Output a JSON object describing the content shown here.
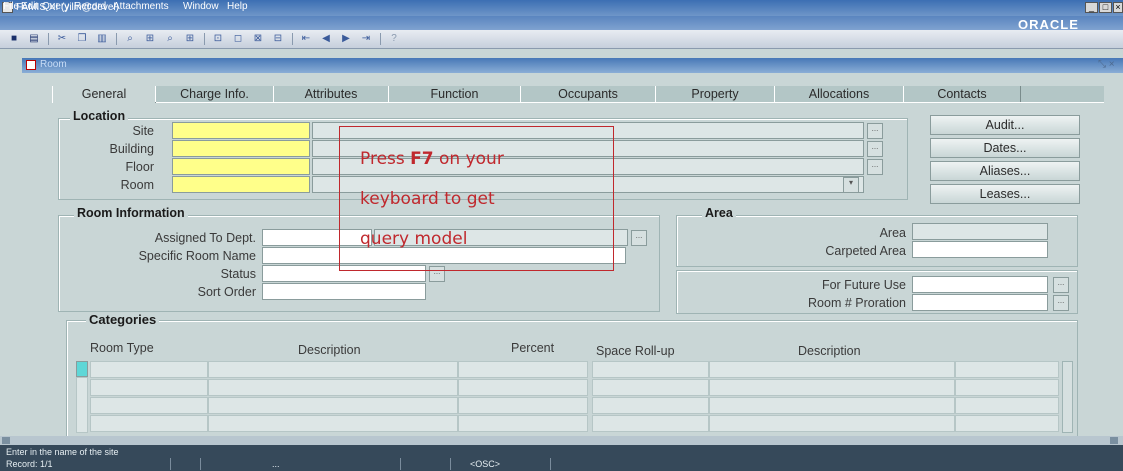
{
  "window": {
    "title": "FAMIS XI (yilin@devel)",
    "brand": "ORACLE"
  },
  "menu": [
    "File",
    "Edit",
    "Query",
    "Record",
    "Attachments",
    "Window",
    "Help"
  ],
  "form": {
    "title": "Room"
  },
  "tabs": [
    "General",
    "Charge Info.",
    "Attributes",
    "Function",
    "Occupants",
    "Property",
    "Allocations",
    "Contacts"
  ],
  "location": {
    "title": "Location",
    "labels": [
      "Site",
      "Building",
      "Floor",
      "Room"
    ]
  },
  "buttons": [
    "Audit...",
    "Dates...",
    "Aliases...",
    "Leases..."
  ],
  "room_info": {
    "title": "Room Information",
    "labels": [
      "Assigned To Dept.",
      "Specific Room Name",
      "Status",
      "Sort Order"
    ]
  },
  "area": {
    "title": "Area",
    "labels": [
      "Area",
      "Carpeted Area",
      "For Future Use",
      "Room # Proration"
    ]
  },
  "categories": {
    "title": "Categories",
    "columns": [
      "Room Type",
      "Description",
      "Percent",
      "Space Roll-up",
      "Description"
    ]
  },
  "annotation": {
    "pre": "Press ",
    "key": "F7",
    "post": " on your",
    "line2": "keyboard  to  get",
    "line3": "query model"
  },
  "status": {
    "message": "Enter in the name of the site",
    "record": "Record: 1/1",
    "ellipsis": "...",
    "osc": "<OSC>"
  },
  "colors": {
    "highlight": "#ffff8a",
    "annotation": "#c0282d"
  }
}
